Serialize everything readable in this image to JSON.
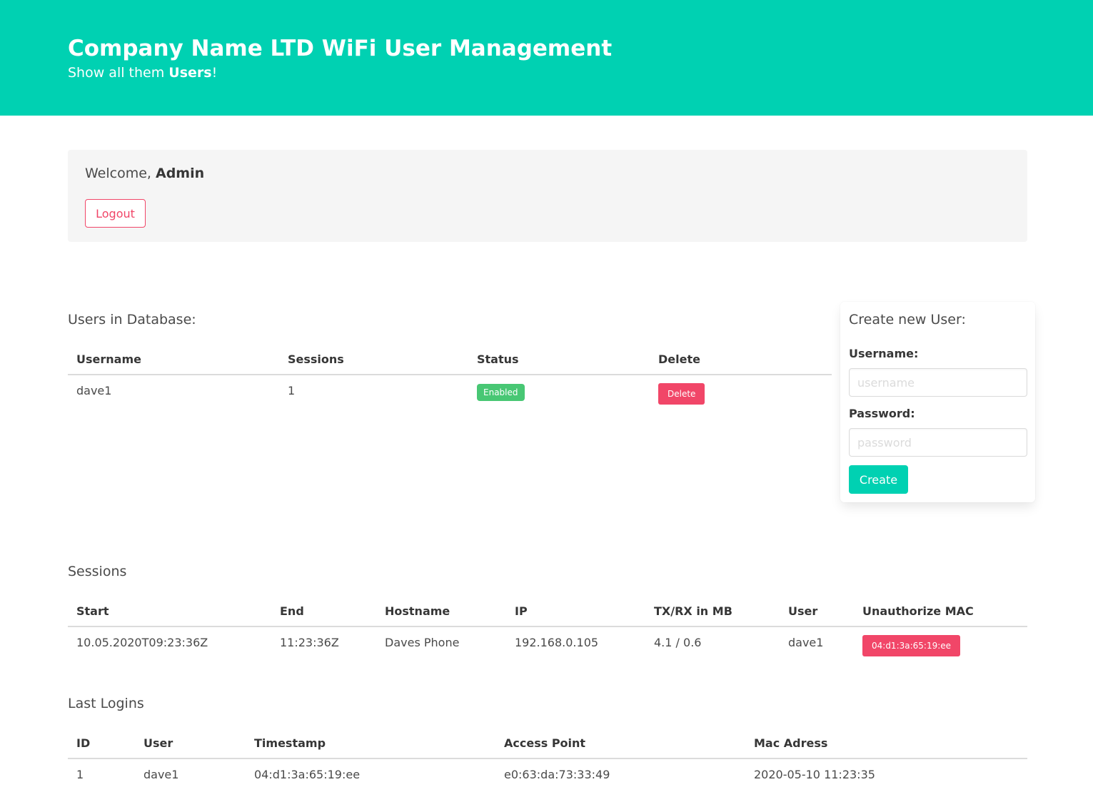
{
  "hero": {
    "title": "Company Name LTD WiFi User Management",
    "subtitle_prefix": "Show all them ",
    "subtitle_bold": "Users",
    "subtitle_suffix": "!",
    "color": "#00d1b2"
  },
  "welcome": {
    "prefix": "Welcome, ",
    "name": "Admin",
    "logout_label": "Logout"
  },
  "users_section": {
    "title": "Users in Database:",
    "columns": [
      "Username",
      "Sessions",
      "Status",
      "Delete"
    ],
    "rows": [
      {
        "username": "dave1",
        "sessions": "1",
        "status": "Enabled",
        "delete_label": "Delete"
      }
    ]
  },
  "create_user": {
    "title": "Create new User:",
    "username_label": "Username:",
    "username_placeholder": "username",
    "password_label": "Password:",
    "password_placeholder": "password",
    "button_label": "Create"
  },
  "sessions_section": {
    "title": "Sessions",
    "columns": [
      "Start",
      "End",
      "Hostname",
      "IP",
      "TX/RX in MB",
      "User",
      "Unauthorize MAC"
    ],
    "rows": [
      {
        "start": "10.05.2020T09:23:36Z",
        "end": "11:23:36Z",
        "hostname": "Daves Phone",
        "ip": "192.168.0.105",
        "txrx": "4.1 / 0.6",
        "user": "dave1",
        "mac": "04:d1:3a:65:19:ee"
      }
    ]
  },
  "logins_section": {
    "title": "Last Logins",
    "columns": [
      "ID",
      "User",
      "Timestamp",
      "Access Point",
      "Mac Adress"
    ],
    "rows": [
      {
        "id": "1",
        "user": "dave1",
        "timestamp": "04:d1:3a:65:19:ee",
        "access_point": "e0:63:da:73:33:49",
        "mac": "2020-05-10 11:23:35"
      }
    ]
  },
  "colors": {
    "primary": "#00d1b2",
    "danger": "#f14668",
    "success": "#48c774"
  }
}
